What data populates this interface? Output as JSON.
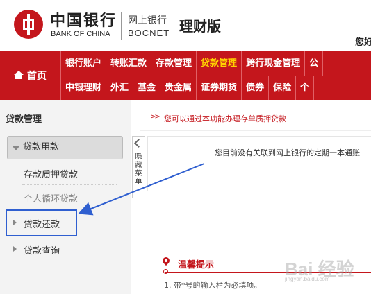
{
  "header": {
    "bank_name_cn": "中国银行",
    "bank_name_en": "BANK OF CHINA",
    "netbank_cn": "网上银行",
    "netbank_en": "BOCNET",
    "edition": "理财版",
    "greeting": "您好"
  },
  "nav": {
    "home": "首页",
    "row1": [
      "银行账户",
      "转账汇款",
      "存款管理",
      "贷款管理",
      "跨行现金管理",
      "公"
    ],
    "row2": [
      "中银理财",
      "外汇",
      "基金",
      "贵金属",
      "证券期货",
      "债券",
      "保险",
      "个"
    ],
    "active": "贷款管理",
    "active_color": "#ffd200"
  },
  "sidebar": {
    "title": "贷款管理",
    "group": "贷款用款",
    "sub_items": [
      "存款质押贷款",
      "个人循环贷款"
    ],
    "items": [
      "贷款还款",
      "贷款查询"
    ],
    "toggle_label": "隐藏菜单"
  },
  "main": {
    "notice_arrows": ">>",
    "notice": "您可以通过本功能办理存单质押贷款",
    "info": "您目前没有关联到网上银行的定期一本通账",
    "tips_title": "温馨提示",
    "tips_line1": "1. 带*号的输入栏为必填项。"
  },
  "watermark": {
    "text": "Bai 经验",
    "sub": "jingyan.baidu.com"
  },
  "colors": {
    "brand_red": "#c4161c",
    "annotation_blue": "#2f5fd0"
  }
}
